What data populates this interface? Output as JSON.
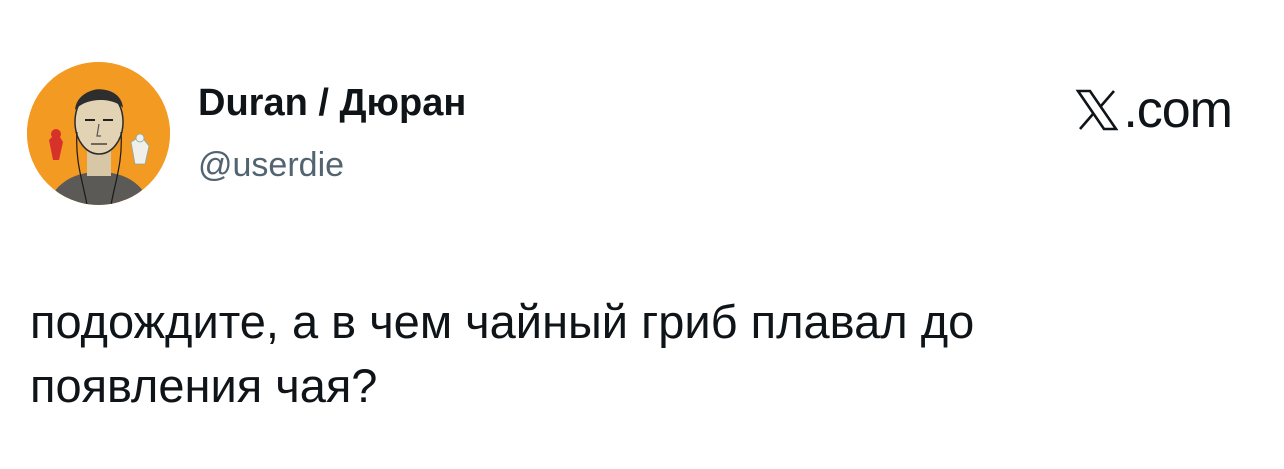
{
  "author": {
    "display_name": "Duran / Дюран",
    "handle": "@userdie",
    "avatar_icon": "avatar-illustration"
  },
  "brand": {
    "icon": "x-logo-icon",
    "label": ".com"
  },
  "tweet": {
    "lines": [
      "подождите, а в чем чайный гриб плавал до",
      "появления чая?"
    ]
  },
  "colors": {
    "avatar_bg": "#f39a22",
    "text_primary": "#0f1419",
    "text_secondary": "#536471"
  }
}
